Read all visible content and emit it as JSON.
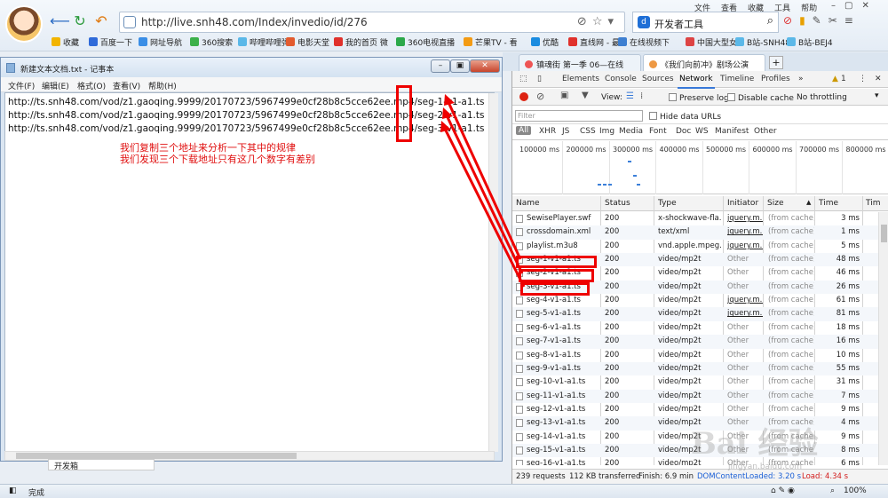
{
  "browser": {
    "url": "http://live.snh48.com/Index/invedio/id/276",
    "search_text": "开发者工具",
    "top_menu": [
      "文件",
      "查看",
      "收藏",
      "工具",
      "帮助"
    ],
    "bookmarks": [
      {
        "label": "收藏",
        "color": "#f2b400"
      },
      {
        "label": "百度一下",
        "color": "#2f6ad9"
      },
      {
        "label": "网址导航",
        "color": "#3a8ee6"
      },
      {
        "label": "360搜索",
        "color": "#3cb04a"
      },
      {
        "label": "哔哩哔哩弹",
        "color": "#5bb8e8"
      },
      {
        "label": "电影天堂",
        "color": "#e35b2f"
      },
      {
        "label": "我的首页 微",
        "color": "#e0312c"
      },
      {
        "label": "360电视直播",
        "color": "#2ca84a"
      },
      {
        "label": "芒果TV - 看",
        "color": "#f39b14"
      },
      {
        "label": "优酷",
        "color": "#1a8ce0"
      },
      {
        "label": "直线网 - 最",
        "color": "#e0312c"
      },
      {
        "label": "在线视频下",
        "color": "#3d7fd1"
      },
      {
        "label": "中国大型女",
        "color": "#d44"
      },
      {
        "label": "B站-SNH48",
        "color": "#5bb8e8"
      },
      {
        "label": "B站-BEJ4",
        "color": "#5bb8e8"
      }
    ],
    "tabs": [
      {
        "label": "镇魂街 第一季 06—在线",
        "active": false
      },
      {
        "label": "《我们向前冲》剧场公演",
        "active": true
      }
    ],
    "status_text": "完成",
    "status_zoom": "100%"
  },
  "notepad": {
    "title": "新建文本文档.txt - 记事本",
    "menu": [
      "文件(F)",
      "编辑(E)",
      "格式(O)",
      "查看(V)",
      "帮助(H)"
    ],
    "lines": [
      "http://ts.snh48.com/vod/z1.gaoqing.9999/20170723/5967499e0cf28b8c5cce62ee.mp4/seg-1-v1-a1.ts",
      "http://ts.snh48.com/vod/z1.gaoqing.9999/20170723/5967499e0cf28b8c5cce62ee.mp4/seg-2-v1-a1.ts",
      "http://ts.snh48.com/vod/z1.gaoqing.9999/20170723/5967499e0cf28b8c5cce62ee.mp4/seg-3-v1-a1.ts"
    ],
    "annotation_line1": "我们复制三个地址来分析一下其中的规律",
    "annotation_line2": "我们发现三个下载地址只有这几个数字有差别",
    "fragment_text": "开发箱"
  },
  "devtools": {
    "tabs": [
      "Elements",
      "Console",
      "Sources",
      "Network",
      "Timeline",
      "Profiles"
    ],
    "active_tab": "Network",
    "more": "»",
    "warning_count": "1",
    "toolbar": {
      "view_label": "View:",
      "preserve_log": "Preserve log",
      "disable_cache": "Disable cache",
      "throttling": "No throttling"
    },
    "filter_placeholder": "Filter",
    "hide_data_urls": "Hide data URLs",
    "types": [
      "All",
      "XHR",
      "JS",
      "CSS",
      "Img",
      "Media",
      "Font",
      "Doc",
      "WS",
      "Manifest",
      "Other"
    ],
    "timeline_ticks": [
      "100000 ms",
      "200000 ms",
      "300000 ms",
      "400000 ms",
      "500000 ms",
      "600000 ms",
      "700000 ms",
      "800000 ms"
    ],
    "columns": [
      "Name",
      "Status",
      "Type",
      "Initiator",
      "Size",
      "Time",
      "Tim"
    ],
    "rows": [
      {
        "name": "SewisePlayer.swf",
        "status": "200",
        "type": "x-shockwave-fla...",
        "initiator": "jquery.m...",
        "size": "(from cache)",
        "time": "3 ms"
      },
      {
        "name": "crossdomain.xml",
        "status": "200",
        "type": "text/xml",
        "initiator": "jquery.m...",
        "size": "(from cache)",
        "time": "1 ms"
      },
      {
        "name": "playlist.m3u8",
        "status": "200",
        "type": "vnd.apple.mpeg...",
        "initiator": "jquery.m...",
        "size": "(from cache)",
        "time": "5 ms"
      },
      {
        "name": "seg-1-v1-a1.ts",
        "status": "200",
        "type": "video/mp2t",
        "initiator": "Other",
        "size": "(from cache)",
        "time": "48 ms"
      },
      {
        "name": "seg-2-v1-a1.ts",
        "status": "200",
        "type": "video/mp2t",
        "initiator": "Other",
        "size": "(from cache)",
        "time": "46 ms"
      },
      {
        "name": "seg-3-v1-a1.ts",
        "status": "200",
        "type": "video/mp2t",
        "initiator": "Other",
        "size": "(from cache)",
        "time": "26 ms"
      },
      {
        "name": "seg-4-v1-a1.ts",
        "status": "200",
        "type": "video/mp2t",
        "initiator": "jquery.m...",
        "size": "(from cache)",
        "time": "61 ms"
      },
      {
        "name": "seg-5-v1-a1.ts",
        "status": "200",
        "type": "video/mp2t",
        "initiator": "jquery.m...",
        "size": "(from cache)",
        "time": "81 ms"
      },
      {
        "name": "seg-6-v1-a1.ts",
        "status": "200",
        "type": "video/mp2t",
        "initiator": "Other",
        "size": "(from cache)",
        "time": "18 ms"
      },
      {
        "name": "seg-7-v1-a1.ts",
        "status": "200",
        "type": "video/mp2t",
        "initiator": "Other",
        "size": "(from cache)",
        "time": "16 ms"
      },
      {
        "name": "seg-8-v1-a1.ts",
        "status": "200",
        "type": "video/mp2t",
        "initiator": "Other",
        "size": "(from cache)",
        "time": "10 ms"
      },
      {
        "name": "seg-9-v1-a1.ts",
        "status": "200",
        "type": "video/mp2t",
        "initiator": "Other",
        "size": "(from cache)",
        "time": "55 ms"
      },
      {
        "name": "seg-10-v1-a1.ts",
        "status": "200",
        "type": "video/mp2t",
        "initiator": "Other",
        "size": "(from cache)",
        "time": "31 ms"
      },
      {
        "name": "seg-11-v1-a1.ts",
        "status": "200",
        "type": "video/mp2t",
        "initiator": "Other",
        "size": "(from cache)",
        "time": "7 ms"
      },
      {
        "name": "seg-12-v1-a1.ts",
        "status": "200",
        "type": "video/mp2t",
        "initiator": "Other",
        "size": "(from cache)",
        "time": "9 ms"
      },
      {
        "name": "seg-13-v1-a1.ts",
        "status": "200",
        "type": "video/mp2t",
        "initiator": "Other",
        "size": "(from cache)",
        "time": "4 ms"
      },
      {
        "name": "seg-14-v1-a1.ts",
        "status": "200",
        "type": "video/mp2t",
        "initiator": "Other",
        "size": "(from cache)",
        "time": "9 ms"
      },
      {
        "name": "seg-15-v1-a1.ts",
        "status": "200",
        "type": "video/mp2t",
        "initiator": "Other",
        "size": "(from cache)",
        "time": "8 ms"
      },
      {
        "name": "seg-16-v1-a1.ts",
        "status": "200",
        "type": "video/mp2t",
        "initiator": "Other",
        "size": "(from cache)",
        "time": "6 ms"
      }
    ],
    "summary": {
      "requests": "239 requests",
      "transferred": "112 KB transferred",
      "finish": "Finish: 6.9 min",
      "dom_loaded": "DOMContentLoaded: 3.20 s",
      "load": "Load: 4.34 s"
    }
  },
  "watermark": {
    "main": "Bai 经验",
    "sub": "jingyan.baidu.com"
  },
  "colors": {
    "annotation_red": "#e00000",
    "dom_loaded_blue": "#1a5fd6",
    "load_red": "#d21a1a"
  }
}
